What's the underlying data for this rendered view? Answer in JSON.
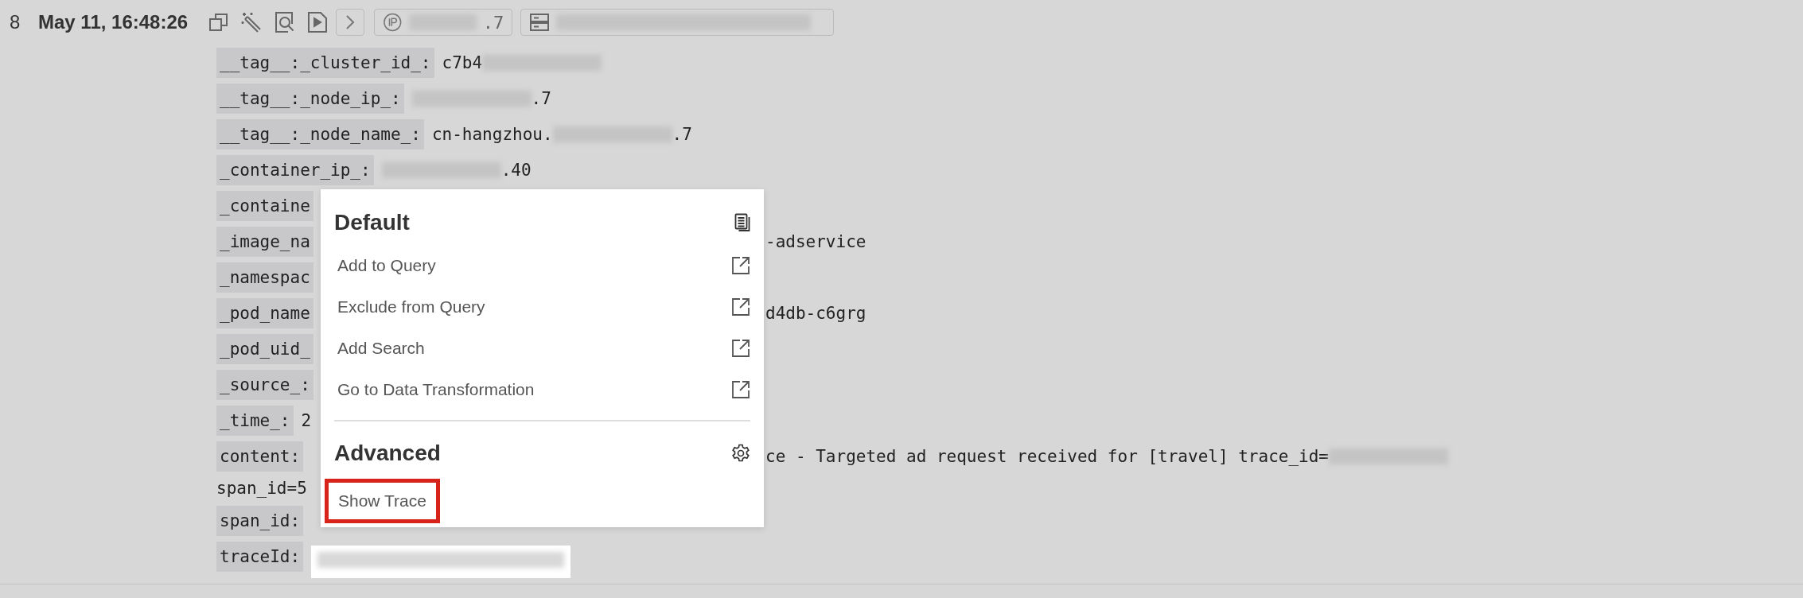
{
  "record": {
    "index": "8",
    "timestamp": "May 11, 16:48:26",
    "ip_parts": [
      {
        "kind": "redacted"
      },
      {
        "kind": "text",
        "text": ".7"
      }
    ],
    "host_parts": [
      {
        "kind": "redacted"
      }
    ]
  },
  "fields": [
    {
      "label": "__tag__:_cluster_id_:",
      "kind": "open",
      "parts": [
        {
          "kind": "text",
          "text": "c7b4"
        },
        {
          "kind": "redacted"
        }
      ]
    },
    {
      "label": "__tag__:_node_ip_:",
      "kind": "open",
      "parts": [
        {
          "kind": "redacted"
        },
        {
          "kind": "text",
          "text": ".7"
        }
      ]
    },
    {
      "label": "__tag__:_node_name_:",
      "kind": "open",
      "parts": [
        {
          "kind": "text",
          "text": "cn-hangzhou."
        },
        {
          "kind": "redacted"
        },
        {
          "kind": "text",
          "text": ".7"
        }
      ]
    },
    {
      "label": "_container_ip_:",
      "kind": "open",
      "parts": [
        {
          "kind": "redacted"
        },
        {
          "kind": "text",
          "text": ".40"
        }
      ]
    },
    {
      "label": "_containe",
      "kind": "covered"
    },
    {
      "label": "_image_na",
      "kind": "covered",
      "tail": [
        {
          "kind": "text",
          "text": "-adservice"
        }
      ]
    },
    {
      "label": "_namespac",
      "kind": "covered"
    },
    {
      "label": "_pod_name",
      "kind": "covered",
      "tail": [
        {
          "kind": "text",
          "text": "d4db-c6grg"
        }
      ]
    },
    {
      "label": "_pod_uid_",
      "kind": "covered"
    },
    {
      "label": "_source_:",
      "kind": "covered"
    },
    {
      "label": "_time_:",
      "kind": "covered",
      "parts": [
        {
          "kind": "text",
          "text": "2"
        }
      ]
    },
    {
      "label": "content:",
      "kind": "covered",
      "tail": [
        {
          "kind": "text",
          "text": "ce - Targeted ad request received for [travel] trace_id="
        },
        {
          "kind": "redacted"
        }
      ],
      "continuation": "span_id=5"
    },
    {
      "label": "span_id:",
      "kind": "covered"
    },
    {
      "label": "traceId:",
      "kind": "open",
      "parts": [
        {
          "kind": "redacted-highlight"
        }
      ]
    }
  ],
  "menu": {
    "sections": [
      {
        "title": "Default",
        "items": [
          {
            "label": "Add to Query",
            "highlighted": false
          },
          {
            "label": "Exclude from Query",
            "highlighted": false
          },
          {
            "label": "Add Search",
            "highlighted": false
          },
          {
            "label": "Go to Data Transformation",
            "highlighted": false
          }
        ]
      },
      {
        "title": "Advanced",
        "items": [
          {
            "label": "Show Trace",
            "highlighted": true
          }
        ]
      }
    ]
  }
}
